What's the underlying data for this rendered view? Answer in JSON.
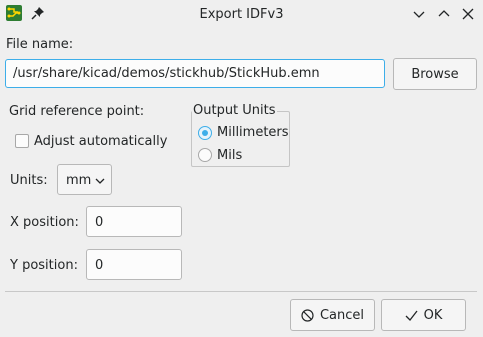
{
  "window": {
    "title": "Export IDFv3",
    "app_icon": "kicad-pcb-icon",
    "pin_icon": "pin-icon",
    "controls": [
      "minimize-icon",
      "maximize-icon",
      "close-icon"
    ]
  },
  "file": {
    "label": "File name:",
    "value": "/usr/share/kicad/demos/stickhub/StickHub.emn",
    "browse_label": "Browse"
  },
  "grid": {
    "label": "Grid reference point:",
    "adjust_label": "Adjust automatically",
    "adjust_checked": false,
    "units_label": "Units:",
    "units_value": "mm",
    "x_label": "X position:",
    "x_value": "0",
    "y_label": "Y position:",
    "y_value": "0"
  },
  "output_units": {
    "title": "Output Units",
    "options": [
      {
        "label": "Millimeters",
        "selected": true
      },
      {
        "label": "Mils",
        "selected": false
      }
    ]
  },
  "buttons": {
    "cancel": "Cancel",
    "ok": "OK"
  },
  "colors": {
    "accent": "#3daee9",
    "background": "#efefef"
  }
}
